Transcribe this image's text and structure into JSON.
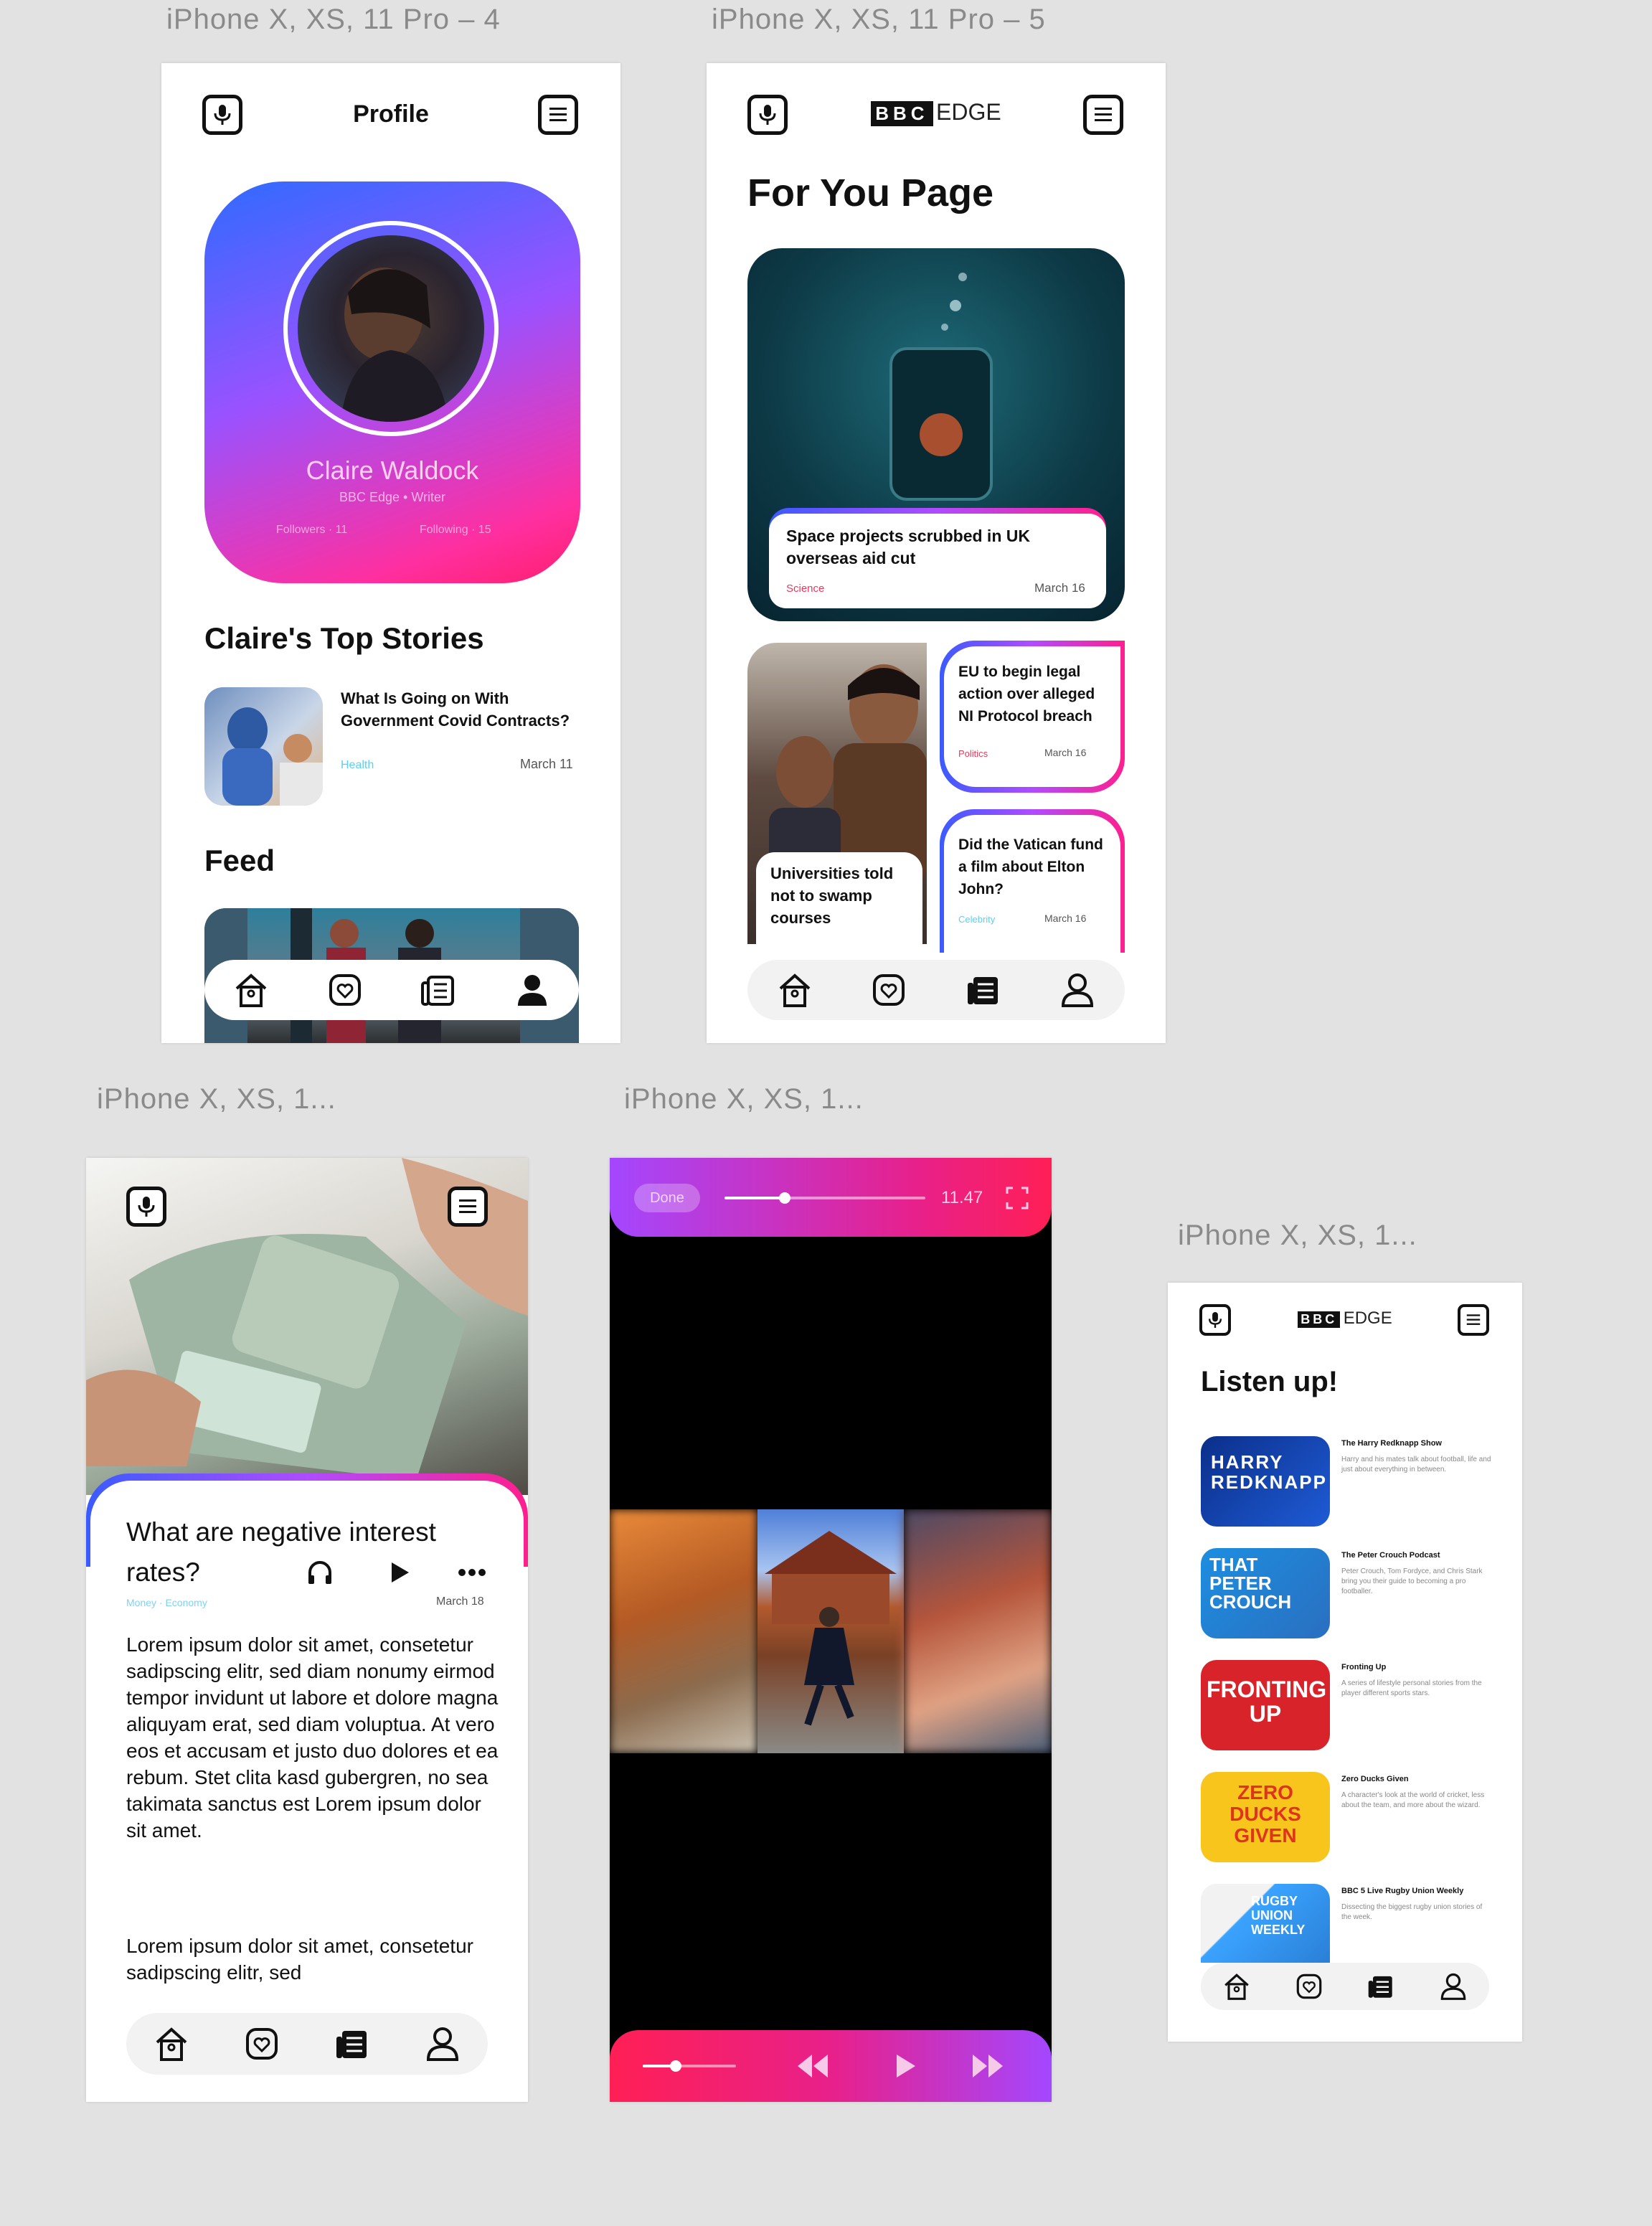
{
  "frames": {
    "profile": {
      "label": "iPhone X, XS, 11 Pro – 4"
    },
    "foryou": {
      "label": "iPhone X, XS, 11 Pro – 5"
    },
    "article": {
      "label": "iPhone X, XS, 1..."
    },
    "video": {
      "label": "iPhone X, XS, 1..."
    },
    "listen": {
      "label": "iPhone X, XS, 1..."
    }
  },
  "profile": {
    "title": "Profile",
    "name": "Claire Waldock",
    "subtitle": "BBC Edge • Writer",
    "followers": "Followers · 11",
    "following": "Following · 15",
    "top_stories_heading": "Claire's Top Stories",
    "story": {
      "title": "What Is Going on With Government Covid Contracts?",
      "category": "Health",
      "date": "March 11"
    },
    "feed_heading": "Feed"
  },
  "foryou": {
    "brand": "BBC",
    "brand_suffix": "EDGE",
    "heading": "For You Page",
    "hero": {
      "title": "Space projects scrubbed in UK overseas aid cut",
      "category": "Science",
      "date": "March 16"
    },
    "left_card": {
      "title": "Universities told not to swamp courses"
    },
    "card1": {
      "title": "EU to begin legal action over alleged NI Protocol breach",
      "category": "Politics",
      "date": "March 16"
    },
    "card2": {
      "title": "Did the Vatican fund a film about Elton John?",
      "category": "Celebrity",
      "date": "March 16"
    }
  },
  "article": {
    "title": "What are negative interest rates?",
    "category": "Money · Economy",
    "date": "March 18",
    "para1": "Lorem ipsum dolor sit amet, consetetur sadipscing elitr, sed diam nonumy eirmod tempor invidunt ut labore et dolore magna aliquyam erat, sed diam voluptua. At vero eos et accusam et justo duo dolores et ea rebum. Stet clita kasd gubergren, no sea takimata sanctus est Lorem ipsum dolor sit amet.",
    "para2": "Lorem ipsum dolor sit amet, consetetur sadipscing elitr, sed"
  },
  "video": {
    "done_label": "Done",
    "time": "11.47",
    "progress": 0.3,
    "volume": 0.35
  },
  "listen": {
    "brand": "BBC",
    "brand_suffix": "EDGE",
    "heading": "Listen up!",
    "podcasts": [
      {
        "cover": "HARRY REDKNAPP",
        "title": "The Harry Redknapp Show",
        "desc": "Harry and his mates talk about football, life and just about everything in between."
      },
      {
        "cover": "THAT PETER CROUCH",
        "title": "The Peter Crouch Podcast",
        "desc": "Peter Crouch, Tom Fordyce, and Chris Stark bring you their guide to becoming a pro footballer."
      },
      {
        "cover": "FRONTING UP",
        "title": "Fronting Up",
        "desc": "A series of lifestyle personal stories from the player different sports stars."
      },
      {
        "cover": "ZERO DUCKS GIVEN",
        "title": "Zero Ducks Given",
        "desc": "A character's look at the world of cricket, less about the team, and more about the wizard."
      },
      {
        "cover": "RUGBY UNION WEEKLY",
        "title": "BBC 5 Live Rugby Union Weekly",
        "desc": "Dissecting the biggest rugby union stories of the week."
      }
    ]
  },
  "colors": {
    "grad_start": "#3b5bff",
    "grad_mid": "#b04bff",
    "grad_end": "#ff1f8e",
    "bg": "#e2e2e2"
  }
}
